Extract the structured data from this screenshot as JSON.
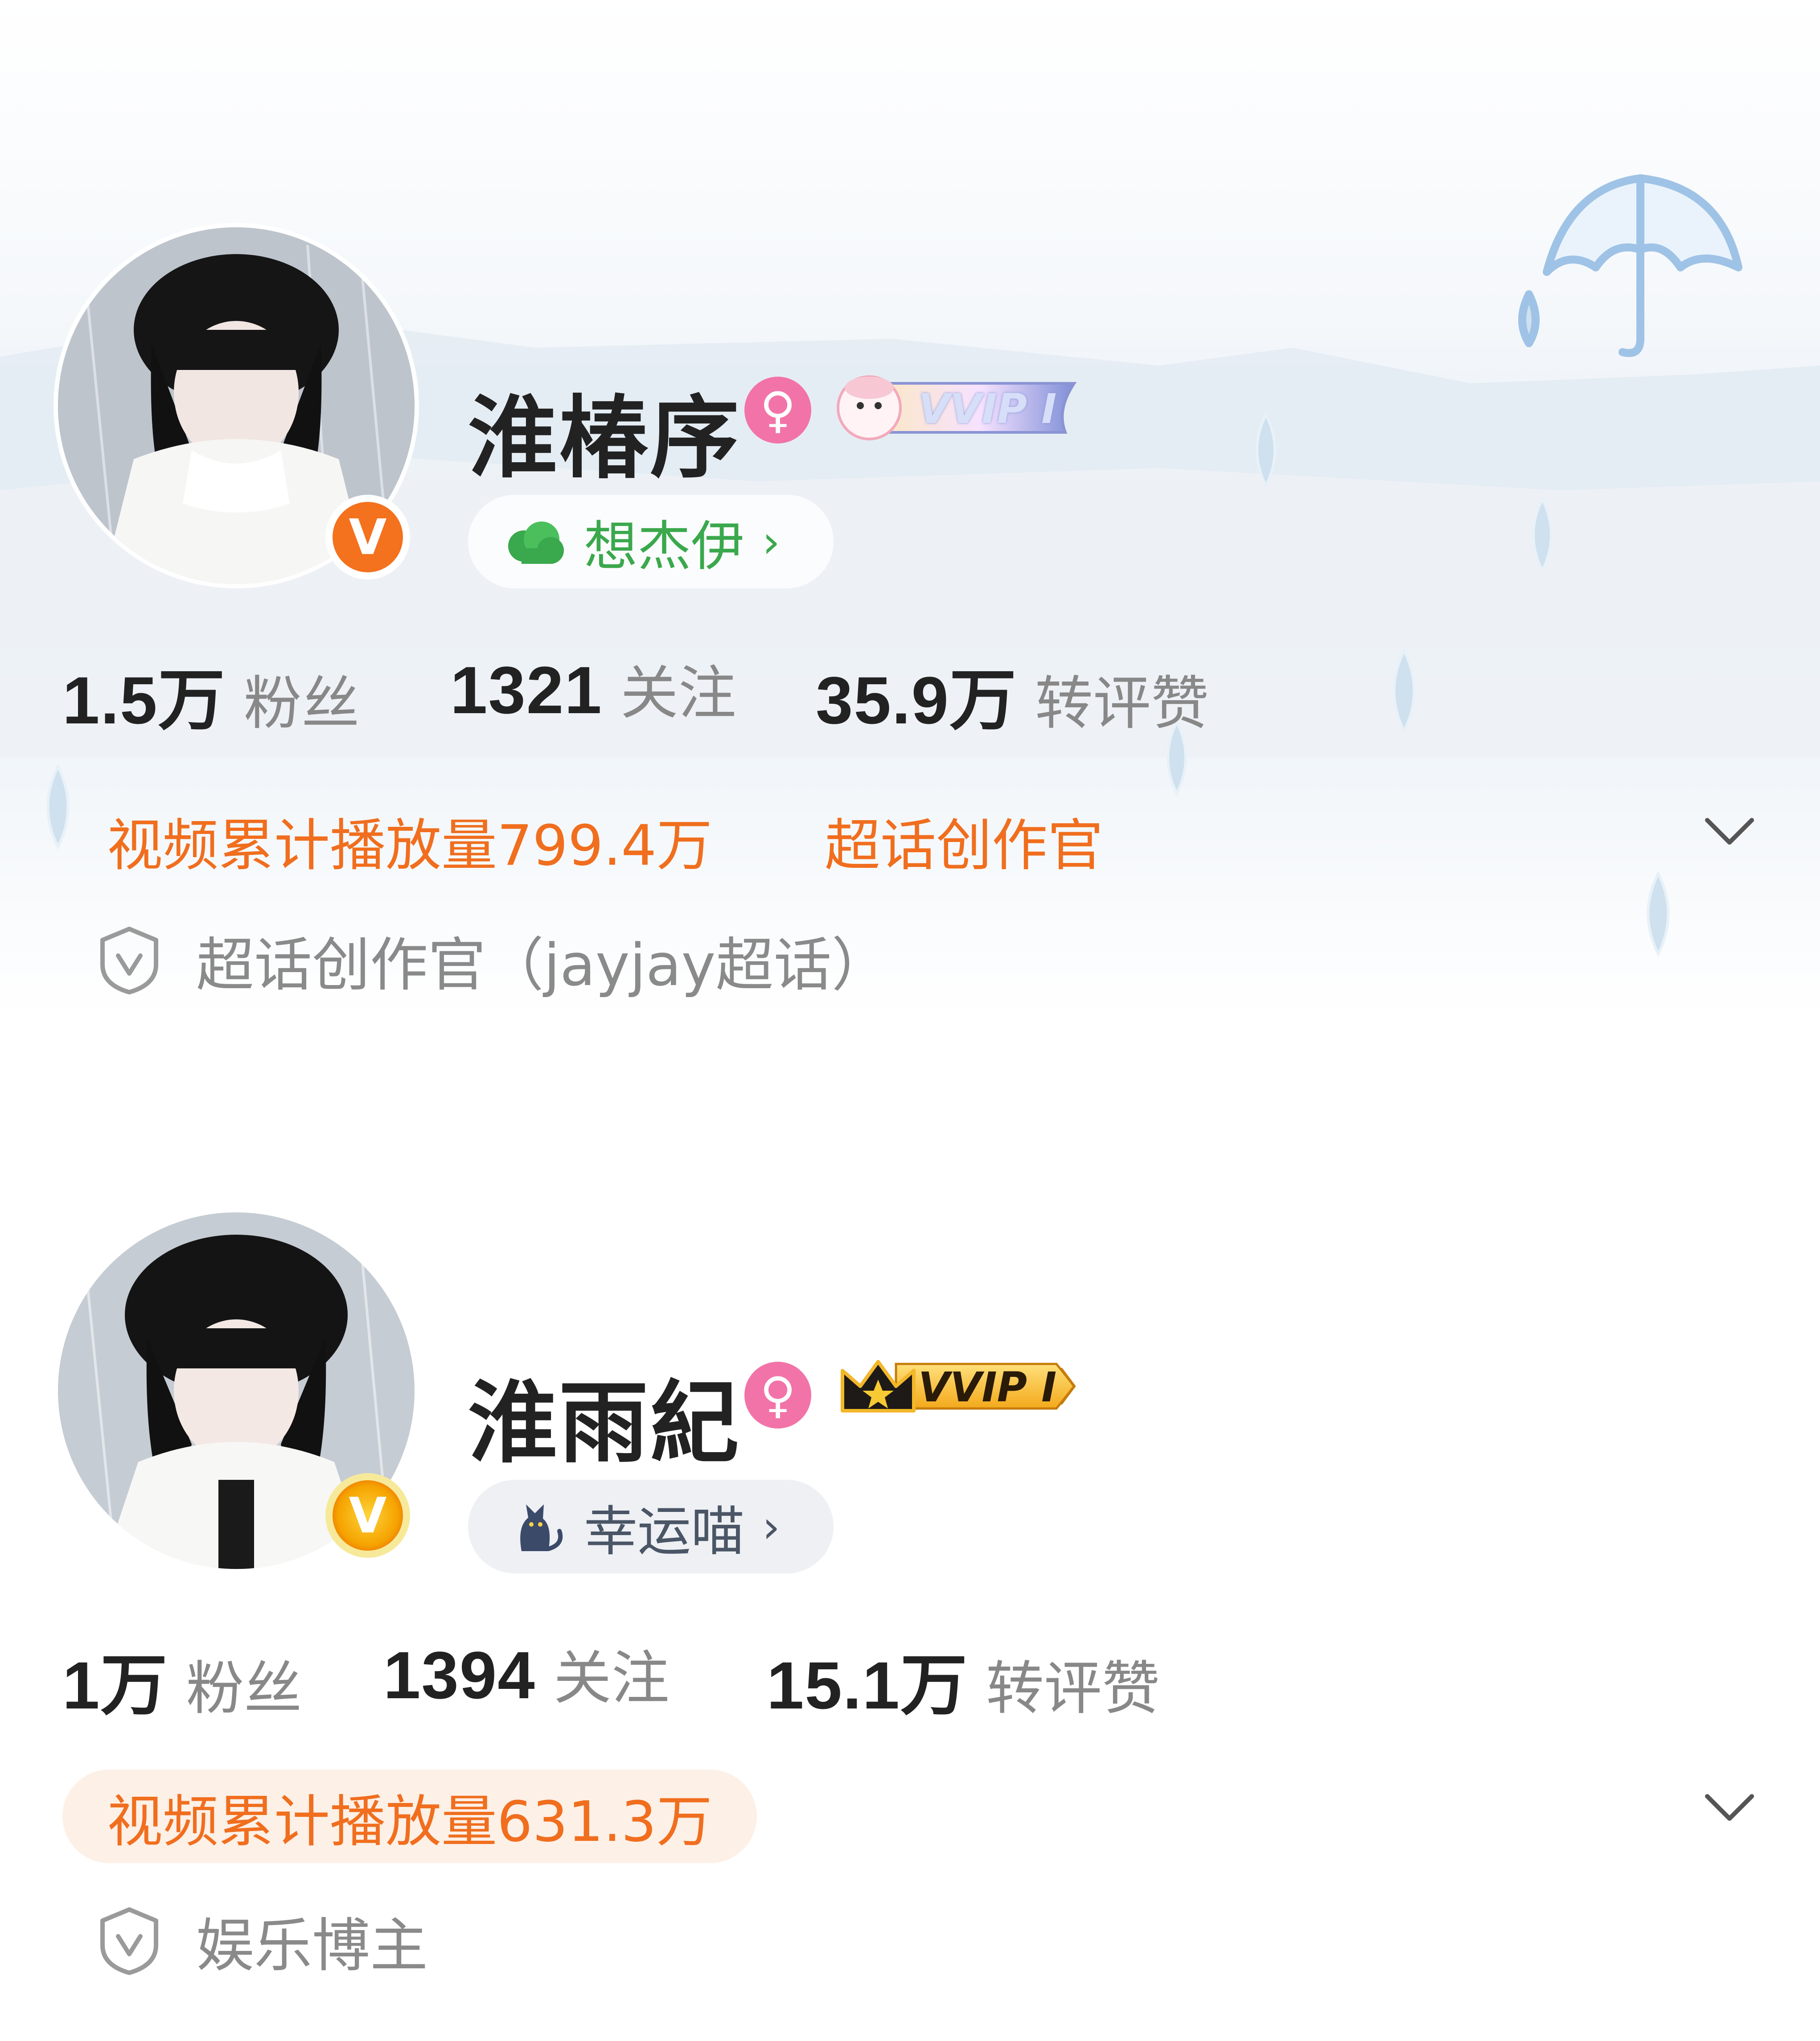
{
  "profiles": [
    {
      "name": "淮椿序",
      "gender_icon": "female-icon",
      "vip_label": "VVIP I",
      "tag": {
        "label": "想杰伊",
        "icon": "cloud-clover-icon"
      },
      "verified_icon": "v-verified-icon",
      "stats": [
        {
          "value": "1.5万",
          "label": "粉丝"
        },
        {
          "value": "1321",
          "label": "关注"
        },
        {
          "value": "35.9万",
          "label": "转评赞"
        }
      ],
      "highlights": [
        "视频累计播放量799.4万",
        "超话创作官"
      ],
      "certification": "超话创作官（jayjay超话）",
      "accent_color": "#f06e1e"
    },
    {
      "name": "淮雨紀",
      "gender_icon": "female-icon",
      "vip_label": "VVIP I",
      "tag": {
        "label": "幸运喵",
        "icon": "cat-icon"
      },
      "verified_icon": "v-verified-gold-icon",
      "stats": [
        {
          "value": "1万",
          "label": "粉丝"
        },
        {
          "value": "1394",
          "label": "关注"
        },
        {
          "value": "15.1万",
          "label": "转评赞"
        }
      ],
      "highlights": [
        "视频累计播放量631.3万"
      ],
      "certification": "娱乐博主",
      "accent_color": "#f06e1e"
    }
  ]
}
